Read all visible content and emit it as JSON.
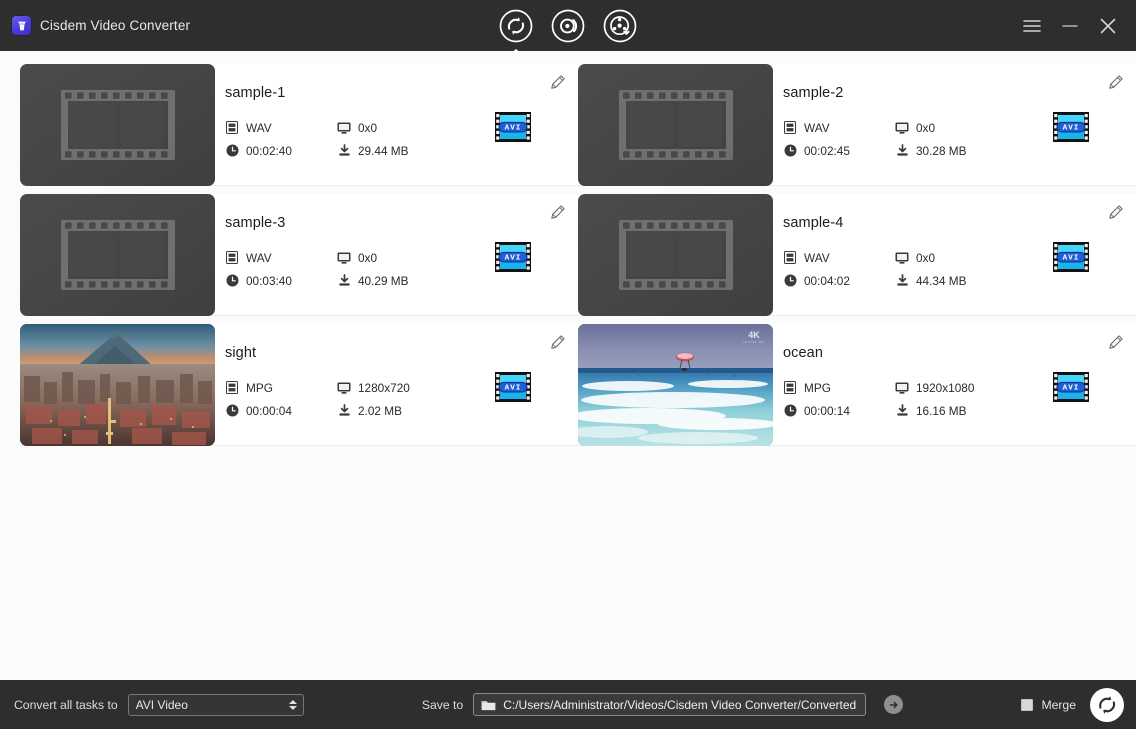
{
  "window": {
    "title": "Cisdem Video Converter",
    "logo_icon": "cisdem-logo-icon",
    "menu_icon": "hamburger-menu-icon",
    "minimize_icon": "minimize-icon",
    "close_icon": "close-icon"
  },
  "modes": [
    {
      "id": "convert",
      "icon": "convert-arrows-icon",
      "active": true
    },
    {
      "id": "rip-dvd",
      "icon": "dvd-rip-icon",
      "active": false
    },
    {
      "id": "download",
      "icon": "download-film-icon",
      "active": false
    }
  ],
  "files": [
    {
      "name": "sample-1",
      "format": "WAV",
      "resolution": "0x0",
      "duration": "00:02:40",
      "size": "29.44 MB",
      "thumb": "placeholder",
      "target_format": "AVI",
      "edit_icon": "pencil-edit-icon"
    },
    {
      "name": "sample-2",
      "format": "WAV",
      "resolution": "0x0",
      "duration": "00:02:45",
      "size": "30.28 MB",
      "thumb": "placeholder",
      "target_format": "AVI",
      "edit_icon": "pencil-edit-icon"
    },
    {
      "name": "sample-3",
      "format": "WAV",
      "resolution": "0x0",
      "duration": "00:03:40",
      "size": "40.29 MB",
      "thumb": "placeholder",
      "target_format": "AVI",
      "edit_icon": "pencil-edit-icon"
    },
    {
      "name": "sample-4",
      "format": "WAV",
      "resolution": "0x0",
      "duration": "00:04:02",
      "size": "44.34 MB",
      "thumb": "placeholder",
      "target_format": "AVI",
      "edit_icon": "pencil-edit-icon"
    },
    {
      "name": "sight",
      "format": "MPG",
      "resolution": "1280x720",
      "duration": "00:00:04",
      "size": "2.02 MB",
      "thumb": "city-volcano-photo",
      "target_format": "AVI",
      "edit_icon": "pencil-edit-icon"
    },
    {
      "name": "ocean",
      "format": "MPG",
      "resolution": "1920x1080",
      "duration": "00:00:14",
      "size": "16.16 MB",
      "thumb": "ocean-waves-photo",
      "thumb_badge": "4K",
      "thumb_badge_sub": "ULTRA HD",
      "target_format": "AVI",
      "edit_icon": "pencil-edit-icon"
    }
  ],
  "icons": {
    "format": "film-strip-icon",
    "resolution": "monitor-icon",
    "duration": "clock-icon",
    "size": "download-size-icon"
  },
  "bottom": {
    "convert_all_label": "Convert all tasks to",
    "format_value": "AVI Video",
    "save_to_label": "Save to",
    "save_path": "C:/Users/Administrator/Videos/Cisdem Video Converter/Converted",
    "folder_icon": "folder-icon",
    "go_icon": "arrow-right-icon",
    "merge_label": "Merge",
    "merge_checked": false,
    "convert_icon": "convert-start-icon"
  },
  "colors": {
    "chrome": "#2e2e2e",
    "page_bg": "#fbfbfb",
    "card_bg": "#ffffff",
    "text_dark": "#1d1d1d",
    "text_light": "#e9e9e9",
    "accent_blue": "#19b4f0",
    "logo_purple": "#5646e0"
  }
}
